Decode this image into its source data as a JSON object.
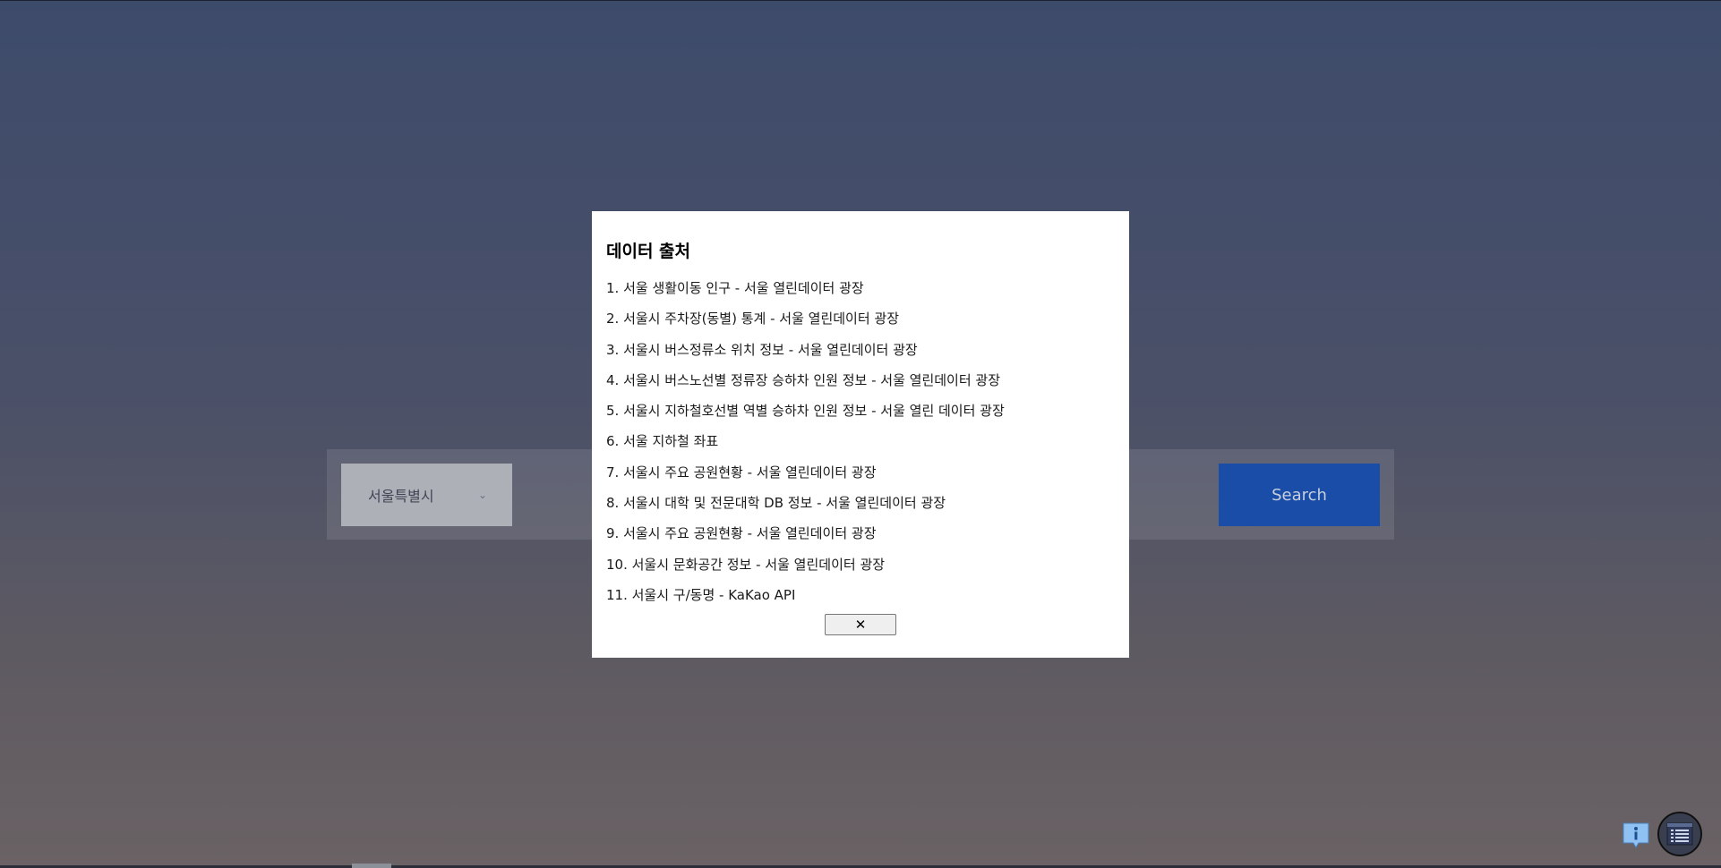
{
  "search": {
    "region_select_value": "서울특별시",
    "search_button_label": "Search"
  },
  "modal": {
    "title": "데이터 출처",
    "sources": [
      "1. 서울 생활이동 인구 - 서울 열린데이터 광장",
      "2. 서울시 주차장(동별) 통계 - 서울 열린데이터 광장",
      "3. 서울시 버스정류소 위치 정보 - 서울 열린데이터 광장",
      "4. 서울시 버스노선별 정류장 승하차 인원 정보 - 서울 열린데이터 광장",
      "5. 서울시 지하철호선별 역별 승하차 인원 정보 - 서울 열린 데이터 광장",
      "6. 서울 지하철 좌표",
      "7. 서울시 주요 공원현황 - 서울 열린데이터 광장",
      "8. 서울시 대학 및 전문대학 DB 정보 - 서울 열린데이터 광장",
      "9. 서울시 주요 공원현황 - 서울 열린데이터 광장",
      "10. 서울시 문화공간 정보 - 서울 열린데이터 광장",
      "11. 서울시 구/동명 - KaKao API"
    ],
    "close_label": "✕"
  },
  "floating": {
    "info_icon": "info-icon",
    "list_icon": "list-icon"
  },
  "colors": {
    "search_button": "#1a4da8",
    "info_icon_bg": "#8fc2f2",
    "modal_bg": "#ffffff"
  }
}
